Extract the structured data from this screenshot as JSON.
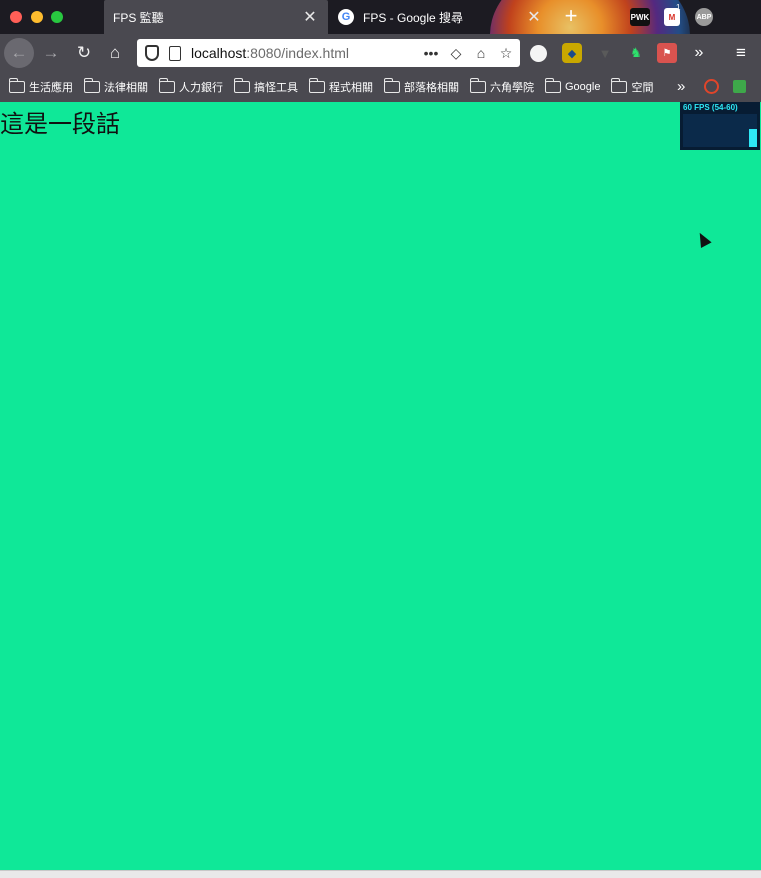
{
  "browser": {
    "tabs": [
      {
        "title": "FPS 監聽",
        "active": true,
        "close": "✕"
      },
      {
        "title": "FPS - Google 搜尋",
        "active": false,
        "close": "✕",
        "favicon": "google-icon"
      }
    ],
    "new_tab": "+",
    "extensions_top": {
      "pwk": "PWK",
      "mail_badge": "1",
      "abp": "ABP"
    },
    "url": {
      "host": "localhost",
      "rest": ":8080/index.html"
    },
    "bookmarks": [
      "生活應用",
      "法律相關",
      "人力銀行",
      "搞怪工具",
      "程式相關",
      "部落格相關",
      "六角學院",
      "Google",
      "空間"
    ],
    "colors": {
      "tabstrip": "#1c1b22",
      "toolbar": "#4a4950"
    }
  },
  "page": {
    "paragraph": "這是一段話",
    "background_color": "#0fe898",
    "fps_monitor": {
      "label": "60 FPS (54-60)",
      "level": 0.55
    }
  }
}
